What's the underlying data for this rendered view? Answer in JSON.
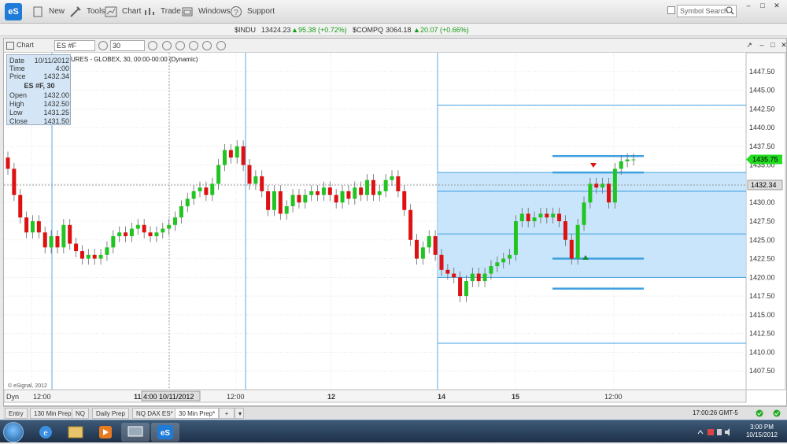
{
  "app": {
    "logo": "eS",
    "menu": [
      {
        "label": "New",
        "icon": "new-icon"
      },
      {
        "label": "Tools",
        "icon": "tools-icon"
      },
      {
        "label": "Chart",
        "icon": "chart-icon"
      },
      {
        "label": "Trade",
        "icon": "trade-icon"
      },
      {
        "label": "Windows",
        "icon": "windows-icon"
      },
      {
        "label": "Support",
        "icon": "support-icon"
      }
    ],
    "symbol_search_placeholder": "Symbol Search"
  },
  "ticker": {
    "indu_sym": "$INDU",
    "indu_val": "13424.23",
    "indu_chg": "95.38 (+0.72%)",
    "compq_sym": "$COMPQ",
    "compq_val": "3064.18",
    "compq_chg": "20.07 (+0.66%)"
  },
  "chartwin": {
    "label": "Chart",
    "symbol": "ES #F",
    "interval": "30",
    "subtitle": "URES - GLOBEX, 30, 00:00-00:00 (Dynamic)",
    "copyright": "© eSignal, 2012"
  },
  "infobox": {
    "date_k": "Date",
    "date_v": "10/11/2012",
    "time_k": "Time",
    "time_v": "4:00",
    "price_k": "Price",
    "price_v": "1432.34",
    "header": "ES #F, 30",
    "open_k": "Open",
    "open_v": "1432.00",
    "high_k": "High",
    "high_v": "1432.50",
    "low_k": "Low",
    "low_v": "1431.25",
    "close_k": "Close",
    "close_v": "1431.50"
  },
  "x_labels": {
    "dyn": "Dyn",
    "t1": "12:00",
    "cursor": "4:00 10/11/2012",
    "t2": "12:00",
    "d12": "12",
    "d14": "14",
    "d15": "15",
    "t3": "12:00"
  },
  "price_tags": {
    "last": "1435.75",
    "cursor": "1432.34"
  },
  "tabs": [
    "Entry",
    "130 Min Prep",
    "NQ",
    "Daily Prep",
    "NQ DAX ES*",
    "30 Min Prep*"
  ],
  "status_clock": "17:00:26 GMT-5",
  "tray": {
    "time": "3:00 PM",
    "date": "10/15/2012"
  },
  "colors": {
    "up": "#22c422",
    "down": "#dd1111",
    "zone": "#bfe0fa",
    "zone_line": "#3fa0e0",
    "accent": "#1f7bd8"
  },
  "chart_data": {
    "type": "candlestick",
    "ylim": [
      1405,
      1450
    ],
    "yticks": [
      "1447.50",
      "1445.00",
      "1442.50",
      "1440.00",
      "1437.50",
      "1435.00",
      "1432.50",
      "1430.00",
      "1427.50",
      "1425.00",
      "1422.50",
      "1420.00",
      "1417.50",
      "1415.00",
      "1412.50",
      "1410.00",
      "1407.50"
    ],
    "series": [
      {
        "o": 1436,
        "c": 1434.5
      },
      {
        "o": 1434.5,
        "c": 1431
      },
      {
        "o": 1431,
        "c": 1428
      },
      {
        "o": 1428,
        "c": 1426
      },
      {
        "o": 1426,
        "c": 1427.5
      },
      {
        "o": 1427.5,
        "c": 1426
      },
      {
        "o": 1426,
        "c": 1424
      },
      {
        "o": 1424,
        "c": 1425.5
      },
      {
        "o": 1425.5,
        "c": 1424
      },
      {
        "o": 1424,
        "c": 1427
      },
      {
        "o": 1427,
        "c": 1424.5
      },
      {
        "o": 1424.5,
        "c": 1423.5
      },
      {
        "o": 1423.5,
        "c": 1422.5
      },
      {
        "o": 1422.5,
        "c": 1423
      },
      {
        "o": 1423,
        "c": 1422.5
      },
      {
        "o": 1422.5,
        "c": 1423
      },
      {
        "o": 1423,
        "c": 1424
      },
      {
        "o": 1424,
        "c": 1425.5
      },
      {
        "o": 1425.5,
        "c": 1426
      },
      {
        "o": 1426,
        "c": 1425.5
      },
      {
        "o": 1425.5,
        "c": 1426.5
      },
      {
        "o": 1426.5,
        "c": 1427
      },
      {
        "o": 1427,
        "c": 1426
      },
      {
        "o": 1426,
        "c": 1425.5
      },
      {
        "o": 1425.5,
        "c": 1426
      },
      {
        "o": 1426,
        "c": 1426.5
      },
      {
        "o": 1426.5,
        "c": 1427
      },
      {
        "o": 1427,
        "c": 1428
      },
      {
        "o": 1428,
        "c": 1429.5
      },
      {
        "o": 1429.5,
        "c": 1430.5
      },
      {
        "o": 1430.5,
        "c": 1431.5
      },
      {
        "o": 1431.5,
        "c": 1432
      },
      {
        "o": 1432,
        "c": 1431
      },
      {
        "o": 1431,
        "c": 1432.5
      },
      {
        "o": 1432.5,
        "c": 1435
      },
      {
        "o": 1435,
        "c": 1437
      },
      {
        "o": 1437,
        "c": 1436
      },
      {
        "o": 1436,
        "c": 1437.5
      },
      {
        "o": 1437.5,
        "c": 1435
      },
      {
        "o": 1435,
        "c": 1432.5
      },
      {
        "o": 1432.5,
        "c": 1433.5
      },
      {
        "o": 1433.5,
        "c": 1431.5
      },
      {
        "o": 1431.5,
        "c": 1429
      },
      {
        "o": 1429,
        "c": 1431.5
      },
      {
        "o": 1431.5,
        "c": 1428.5
      },
      {
        "o": 1428.5,
        "c": 1429.5
      },
      {
        "o": 1429.5,
        "c": 1431
      },
      {
        "o": 1431,
        "c": 1430
      },
      {
        "o": 1430,
        "c": 1431
      },
      {
        "o": 1431,
        "c": 1431.5
      },
      {
        "o": 1431.5,
        "c": 1431
      },
      {
        "o": 1431,
        "c": 1432
      },
      {
        "o": 1432,
        "c": 1431
      },
      {
        "o": 1431,
        "c": 1430
      },
      {
        "o": 1430,
        "c": 1431.5
      },
      {
        "o": 1431.5,
        "c": 1430.5
      },
      {
        "o": 1430.5,
        "c": 1432
      },
      {
        "o": 1432,
        "c": 1431
      },
      {
        "o": 1431,
        "c": 1433
      },
      {
        "o": 1433,
        "c": 1431
      },
      {
        "o": 1431,
        "c": 1431.5
      },
      {
        "o": 1431.5,
        "c": 1433
      },
      {
        "o": 1433,
        "c": 1433.5
      },
      {
        "o": 1433.5,
        "c": 1431.5
      },
      {
        "o": 1431.5,
        "c": 1429
      },
      {
        "o": 1429,
        "c": 1425
      },
      {
        "o": 1425,
        "c": 1422.5
      },
      {
        "o": 1422.5,
        "c": 1424
      },
      {
        "o": 1424,
        "c": 1425.5
      },
      {
        "o": 1425.5,
        "c": 1423
      },
      {
        "o": 1423,
        "c": 1421
      },
      {
        "o": 1421,
        "c": 1420.5
      },
      {
        "o": 1420.5,
        "c": 1420
      },
      {
        "o": 1420,
        "c": 1417.5
      },
      {
        "o": 1417.5,
        "c": 1419.5
      },
      {
        "o": 1419.5,
        "c": 1420.5
      },
      {
        "o": 1420.5,
        "c": 1419.5
      },
      {
        "o": 1419.5,
        "c": 1420.5
      },
      {
        "o": 1420.5,
        "c": 1421.5
      },
      {
        "o": 1421.5,
        "c": 1422
      },
      {
        "o": 1422,
        "c": 1422.5
      },
      {
        "o": 1422.5,
        "c": 1423
      },
      {
        "o": 1423,
        "c": 1427.5
      },
      {
        "o": 1427.5,
        "c": 1428.5
      },
      {
        "o": 1428.5,
        "c": 1427.5
      },
      {
        "o": 1427.5,
        "c": 1428
      },
      {
        "o": 1428,
        "c": 1428.5
      },
      {
        "o": 1428.5,
        "c": 1428
      },
      {
        "o": 1428,
        "c": 1428.5
      },
      {
        "o": 1428.5,
        "c": 1427.5
      },
      {
        "o": 1427.5,
        "c": 1425
      },
      {
        "o": 1425,
        "c": 1422.5
      },
      {
        "o": 1422.5,
        "c": 1427
      },
      {
        "o": 1427,
        "c": 1430
      },
      {
        "o": 1430,
        "c": 1432.5
      },
      {
        "o": 1432.5,
        "c": 1432
      },
      {
        "o": 1432,
        "c": 1432.5
      },
      {
        "o": 1432.5,
        "c": 1430
      },
      {
        "o": 1430,
        "c": 1434.5
      },
      {
        "o": 1434.5,
        "c": 1435.5
      },
      {
        "o": 1435.5,
        "c": 1435.75
      },
      {
        "o": 1435.75,
        "c": 1435.75
      }
    ]
  }
}
